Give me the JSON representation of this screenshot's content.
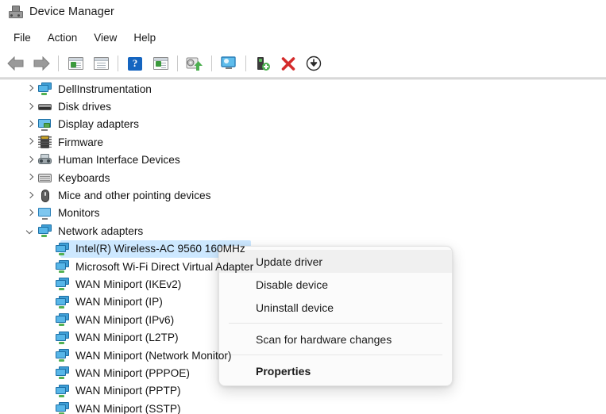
{
  "window": {
    "title": "Device Manager",
    "icon": "device-manager-icon"
  },
  "menubar": {
    "items": [
      {
        "label": "File",
        "name": "menu-file"
      },
      {
        "label": "Action",
        "name": "menu-action"
      },
      {
        "label": "View",
        "name": "menu-view"
      },
      {
        "label": "Help",
        "name": "menu-help"
      }
    ]
  },
  "toolbar": {
    "buttons": [
      {
        "icon": "back-arrow-icon",
        "label": "Back"
      },
      {
        "icon": "forward-arrow-icon",
        "label": "Forward"
      },
      {
        "icon": "show-console-tree-icon",
        "label": "Show/Hide console tree"
      },
      {
        "icon": "properties-window-icon",
        "label": "Properties"
      },
      {
        "icon": "help-icon",
        "label": "Help"
      },
      {
        "icon": "show-details-icon",
        "label": "Show details"
      },
      {
        "icon": "update-driver-icon",
        "label": "Update driver"
      },
      {
        "icon": "scan-monitor-icon",
        "label": "Scan for hardware changes"
      },
      {
        "icon": "add-device-icon",
        "label": "Add drivers"
      },
      {
        "icon": "uninstall-device-icon",
        "label": "Uninstall device"
      },
      {
        "icon": "disable-device-icon",
        "label": "Disable device"
      }
    ]
  },
  "tree": {
    "rows": [
      {
        "label": "DellInstrumentation",
        "icon": "network-computer-icon",
        "expander": "collapsed",
        "level": 0,
        "selected": false
      },
      {
        "label": "Disk drives",
        "icon": "disk-drive-icon",
        "expander": "collapsed",
        "level": 0,
        "selected": false
      },
      {
        "label": "Display adapters",
        "icon": "display-adapter-icon",
        "expander": "collapsed",
        "level": 0,
        "selected": false
      },
      {
        "label": "Firmware",
        "icon": "firmware-chip-icon",
        "expander": "collapsed",
        "level": 0,
        "selected": false
      },
      {
        "label": "Human Interface Devices",
        "icon": "hid-device-icon",
        "expander": "collapsed",
        "level": 0,
        "selected": false
      },
      {
        "label": "Keyboards",
        "icon": "keyboard-icon",
        "expander": "collapsed",
        "level": 0,
        "selected": false
      },
      {
        "label": "Mice and other pointing devices",
        "icon": "mouse-icon",
        "expander": "collapsed",
        "level": 0,
        "selected": false
      },
      {
        "label": "Monitors",
        "icon": "monitor-icon",
        "expander": "collapsed",
        "level": 0,
        "selected": false
      },
      {
        "label": "Network adapters",
        "icon": "network-computer-icon",
        "expander": "expanded",
        "level": 0,
        "selected": false
      },
      {
        "label": "Intel(R) Wireless-AC 9560 160MHz",
        "icon": "network-adapter-icon",
        "expander": "none",
        "level": 1,
        "selected": true
      },
      {
        "label": "Microsoft Wi-Fi Direct Virtual Adapter",
        "icon": "network-adapter-icon",
        "expander": "none",
        "level": 1,
        "selected": false
      },
      {
        "label": "WAN Miniport (IKEv2)",
        "icon": "network-adapter-icon",
        "expander": "none",
        "level": 1,
        "selected": false
      },
      {
        "label": "WAN Miniport (IP)",
        "icon": "network-adapter-icon",
        "expander": "none",
        "level": 1,
        "selected": false
      },
      {
        "label": "WAN Miniport (IPv6)",
        "icon": "network-adapter-icon",
        "expander": "none",
        "level": 1,
        "selected": false
      },
      {
        "label": "WAN Miniport (L2TP)",
        "icon": "network-adapter-icon",
        "expander": "none",
        "level": 1,
        "selected": false
      },
      {
        "label": "WAN Miniport (Network Monitor)",
        "icon": "network-adapter-icon",
        "expander": "none",
        "level": 1,
        "selected": false
      },
      {
        "label": "WAN Miniport (PPPOE)",
        "icon": "network-adapter-icon",
        "expander": "none",
        "level": 1,
        "selected": false
      },
      {
        "label": "WAN Miniport (PPTP)",
        "icon": "network-adapter-icon",
        "expander": "none",
        "level": 1,
        "selected": false
      },
      {
        "label": "WAN Miniport (SSTP)",
        "icon": "network-adapter-icon",
        "expander": "none",
        "level": 1,
        "selected": false
      }
    ]
  },
  "context_menu": {
    "items": [
      {
        "label": "Update driver",
        "name": "context-menu-update-driver",
        "hover": true,
        "bold": false
      },
      {
        "label": "Disable device",
        "name": "context-menu-disable-device",
        "hover": false,
        "bold": false
      },
      {
        "label": "Uninstall device",
        "name": "context-menu-uninstall-device",
        "hover": false,
        "bold": false
      },
      {
        "label": "Scan for hardware changes",
        "name": "context-menu-scan-hardware",
        "hover": false,
        "bold": false
      },
      {
        "label": "Properties",
        "name": "context-menu-properties",
        "hover": false,
        "bold": true
      }
    ]
  },
  "colors": {
    "selection": "#cde8ff",
    "hover": "#f0f0f0",
    "accent_blue": "#57b6e8",
    "uninstall_red": "#d42b2b",
    "device_green": "#52b152"
  }
}
